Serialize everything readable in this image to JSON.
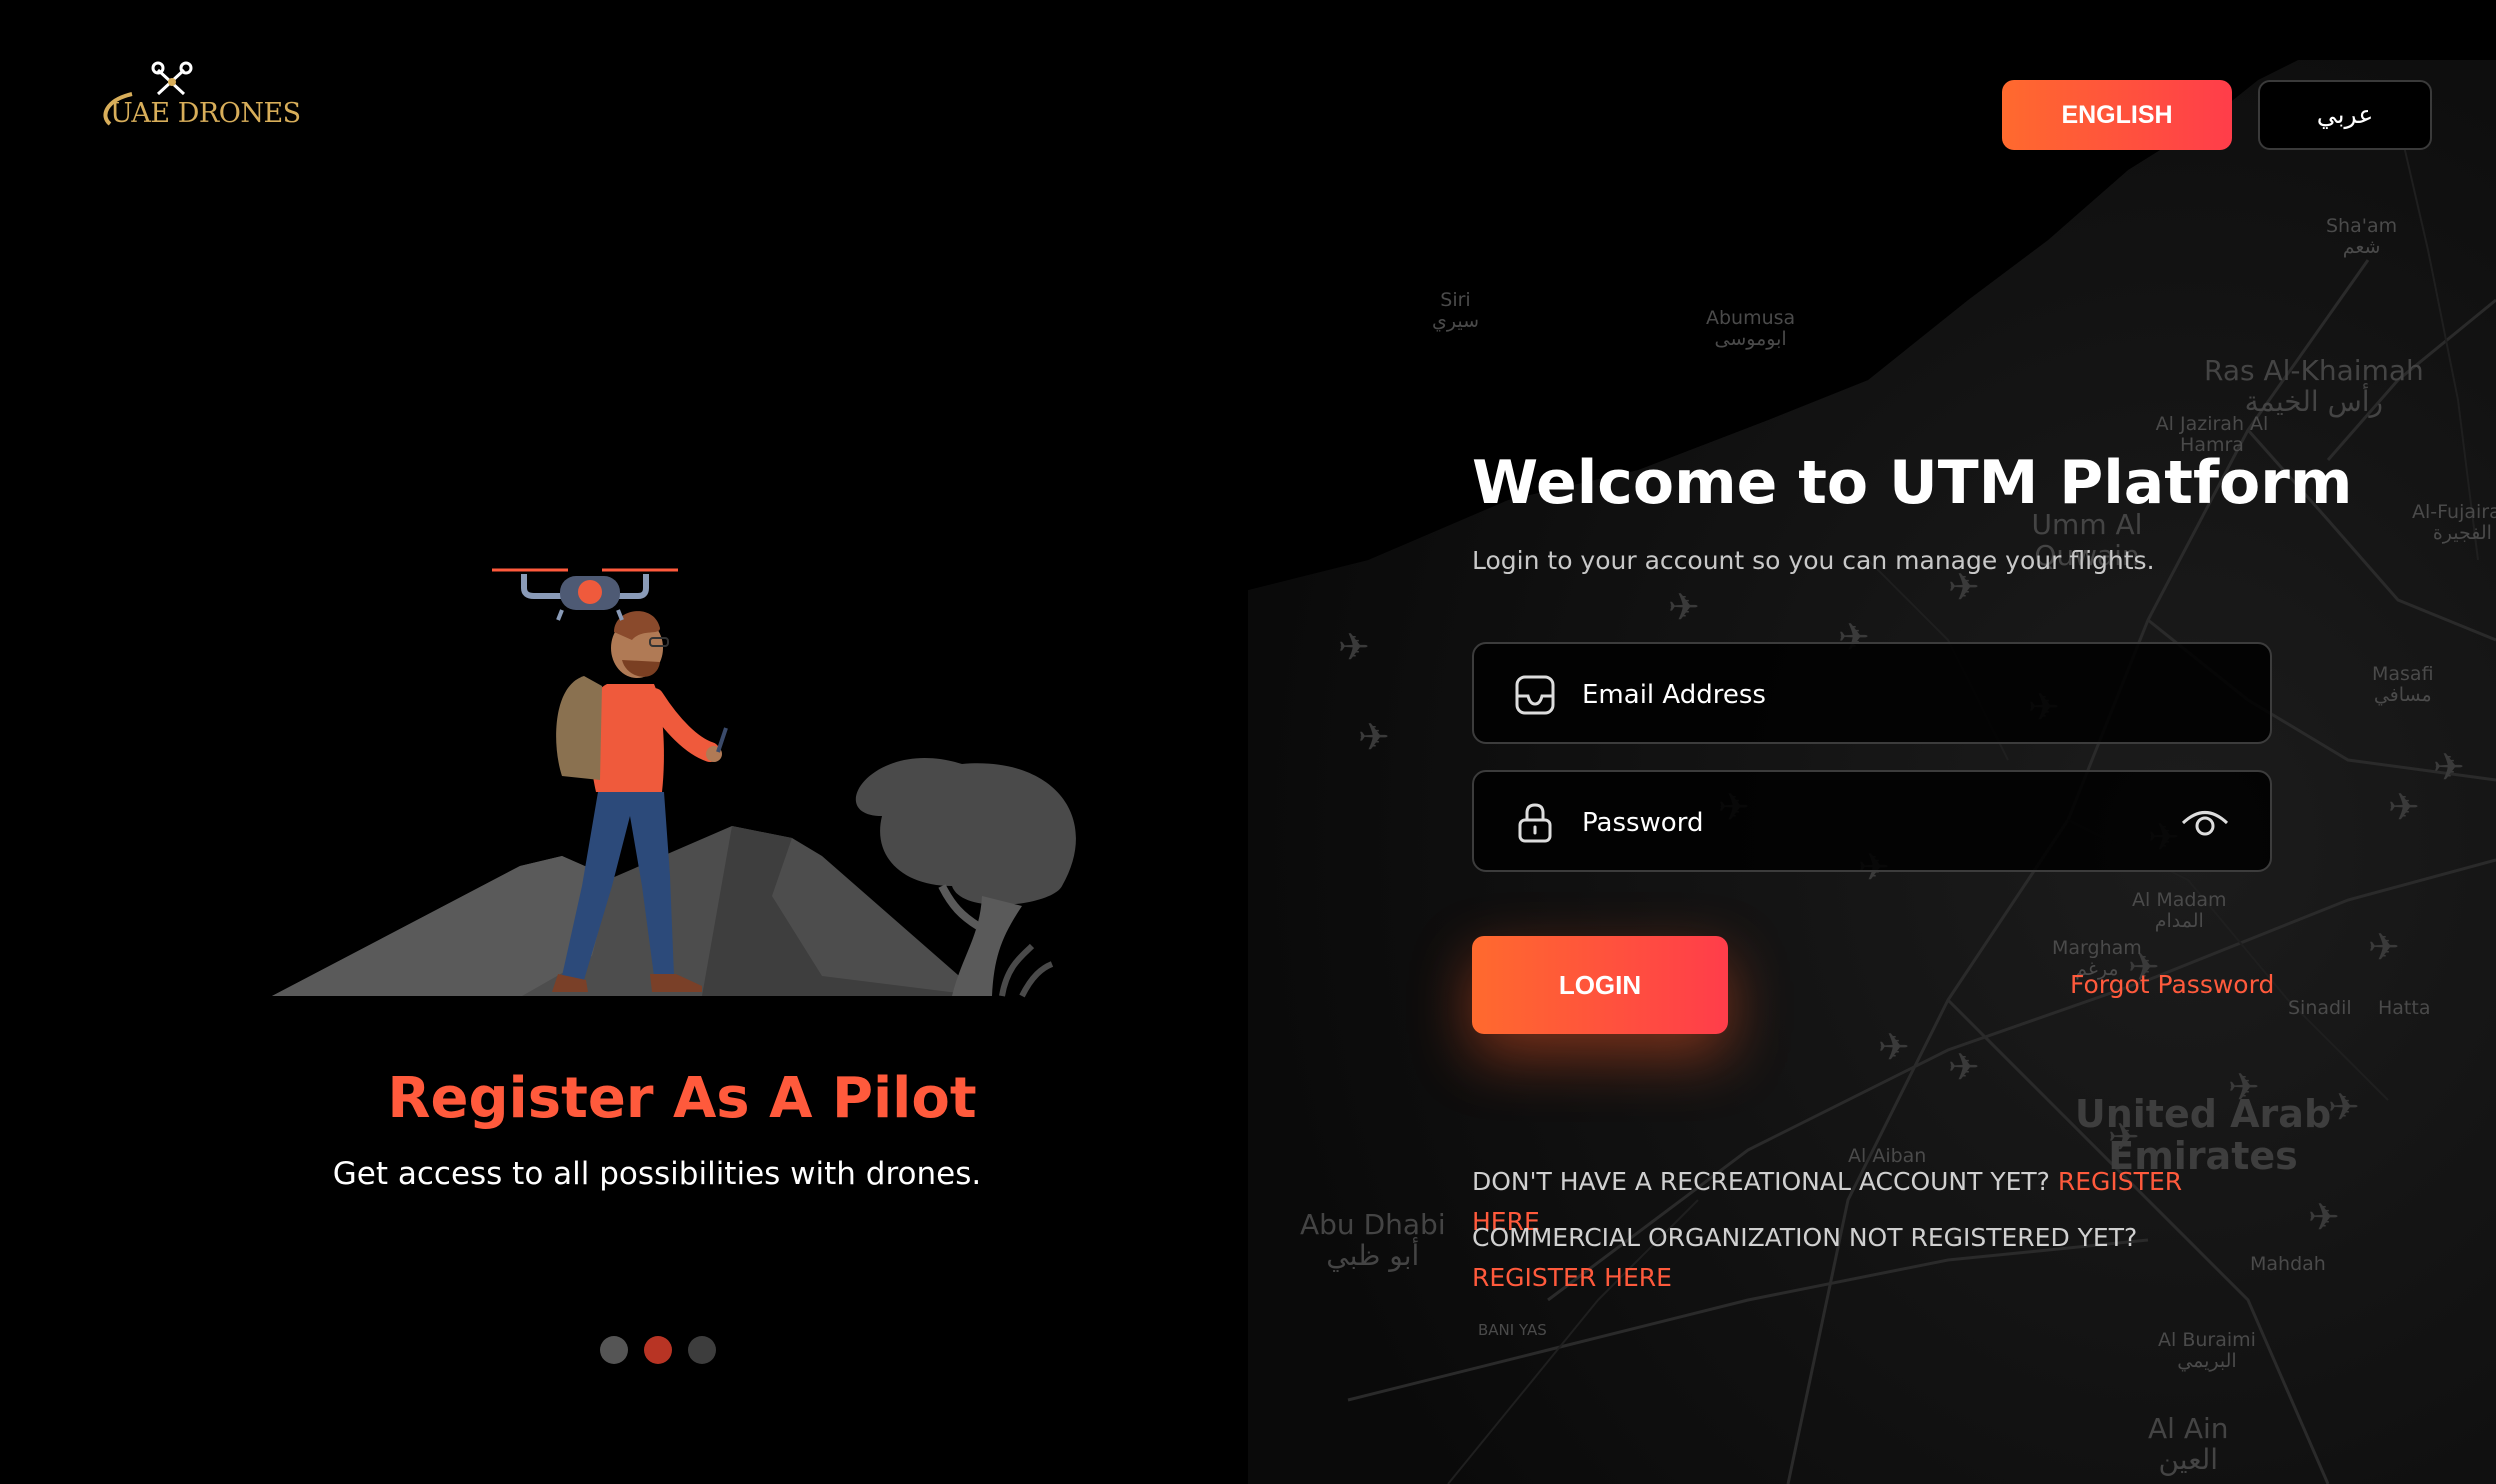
{
  "logo": {
    "text": "UAE DRONES"
  },
  "language": {
    "english_label": "ENGLISH",
    "arabic_label": "عربي"
  },
  "carousel": {
    "title": "Register As A Pilot",
    "subtitle": "Get access to all possibilities with drones.",
    "slide_count": 3,
    "active_index": 1
  },
  "login": {
    "title": "Welcome to UTM Platform",
    "subtitle": "Login to your account so you can manage your flights.",
    "email_placeholder": "Email Address",
    "password_placeholder": "Password",
    "login_label": "LOGIN",
    "forgot_label": "Forgot Password"
  },
  "register": {
    "recreational_text": "DON'T HAVE A RECREATIONAL ACCOUNT YET? ",
    "recreational_link": "REGISTER HERE",
    "commercial_text": "COMMERCIAL ORGANIZATION NOT REGISTERED YET? ",
    "commercial_link": "REGISTER HERE"
  },
  "map_labels": {
    "siri": "Siri",
    "siri_ar": "سيري",
    "abumusa": "Abumusa",
    "abumusa_ar": "ابوموسى",
    "rak": "Ras Al-Khaimah",
    "rak_ar": "رأس الخيمة",
    "shaam": "Sha'am",
    "shaam_ar": "شعم",
    "aljazirah": "Al Jazirah Al Hamra",
    "ummalquwain": "Umm Al Quwain",
    "masafi": "Masafi",
    "masafi_ar": "مسافي",
    "fujairah": "Al-Fujairah",
    "fujairah_ar": "الفجيرة",
    "almadam": "Al Madam",
    "almadam_ar": "المدام",
    "margham": "Margham",
    "margham_ar": "مرغم",
    "uae": "United Arab Emirates",
    "abudhabi": "Abu Dhabi",
    "abudhabi_ar": "أبو ظبي",
    "alaiban": "Al Aiban",
    "baniyas": "BANI YAS",
    "mahdah": "Mahdah",
    "alburaimi": "Al Buraimi",
    "alburaimi_ar": "البريمي",
    "alain": "Al Ain",
    "alain_ar": "العين",
    "hatta": "Hatta",
    "sinadil": "Sinadil"
  },
  "colors": {
    "accent_start": "#ff6a2e",
    "accent_end": "#ff3d4a",
    "link": "#ff5a3c",
    "logo_gold": "#d8ae5a",
    "background": "#000000"
  },
  "icons": {
    "email_field": "inbox-icon",
    "password_field": "lock-icon",
    "password_toggle": "eye-icon"
  }
}
